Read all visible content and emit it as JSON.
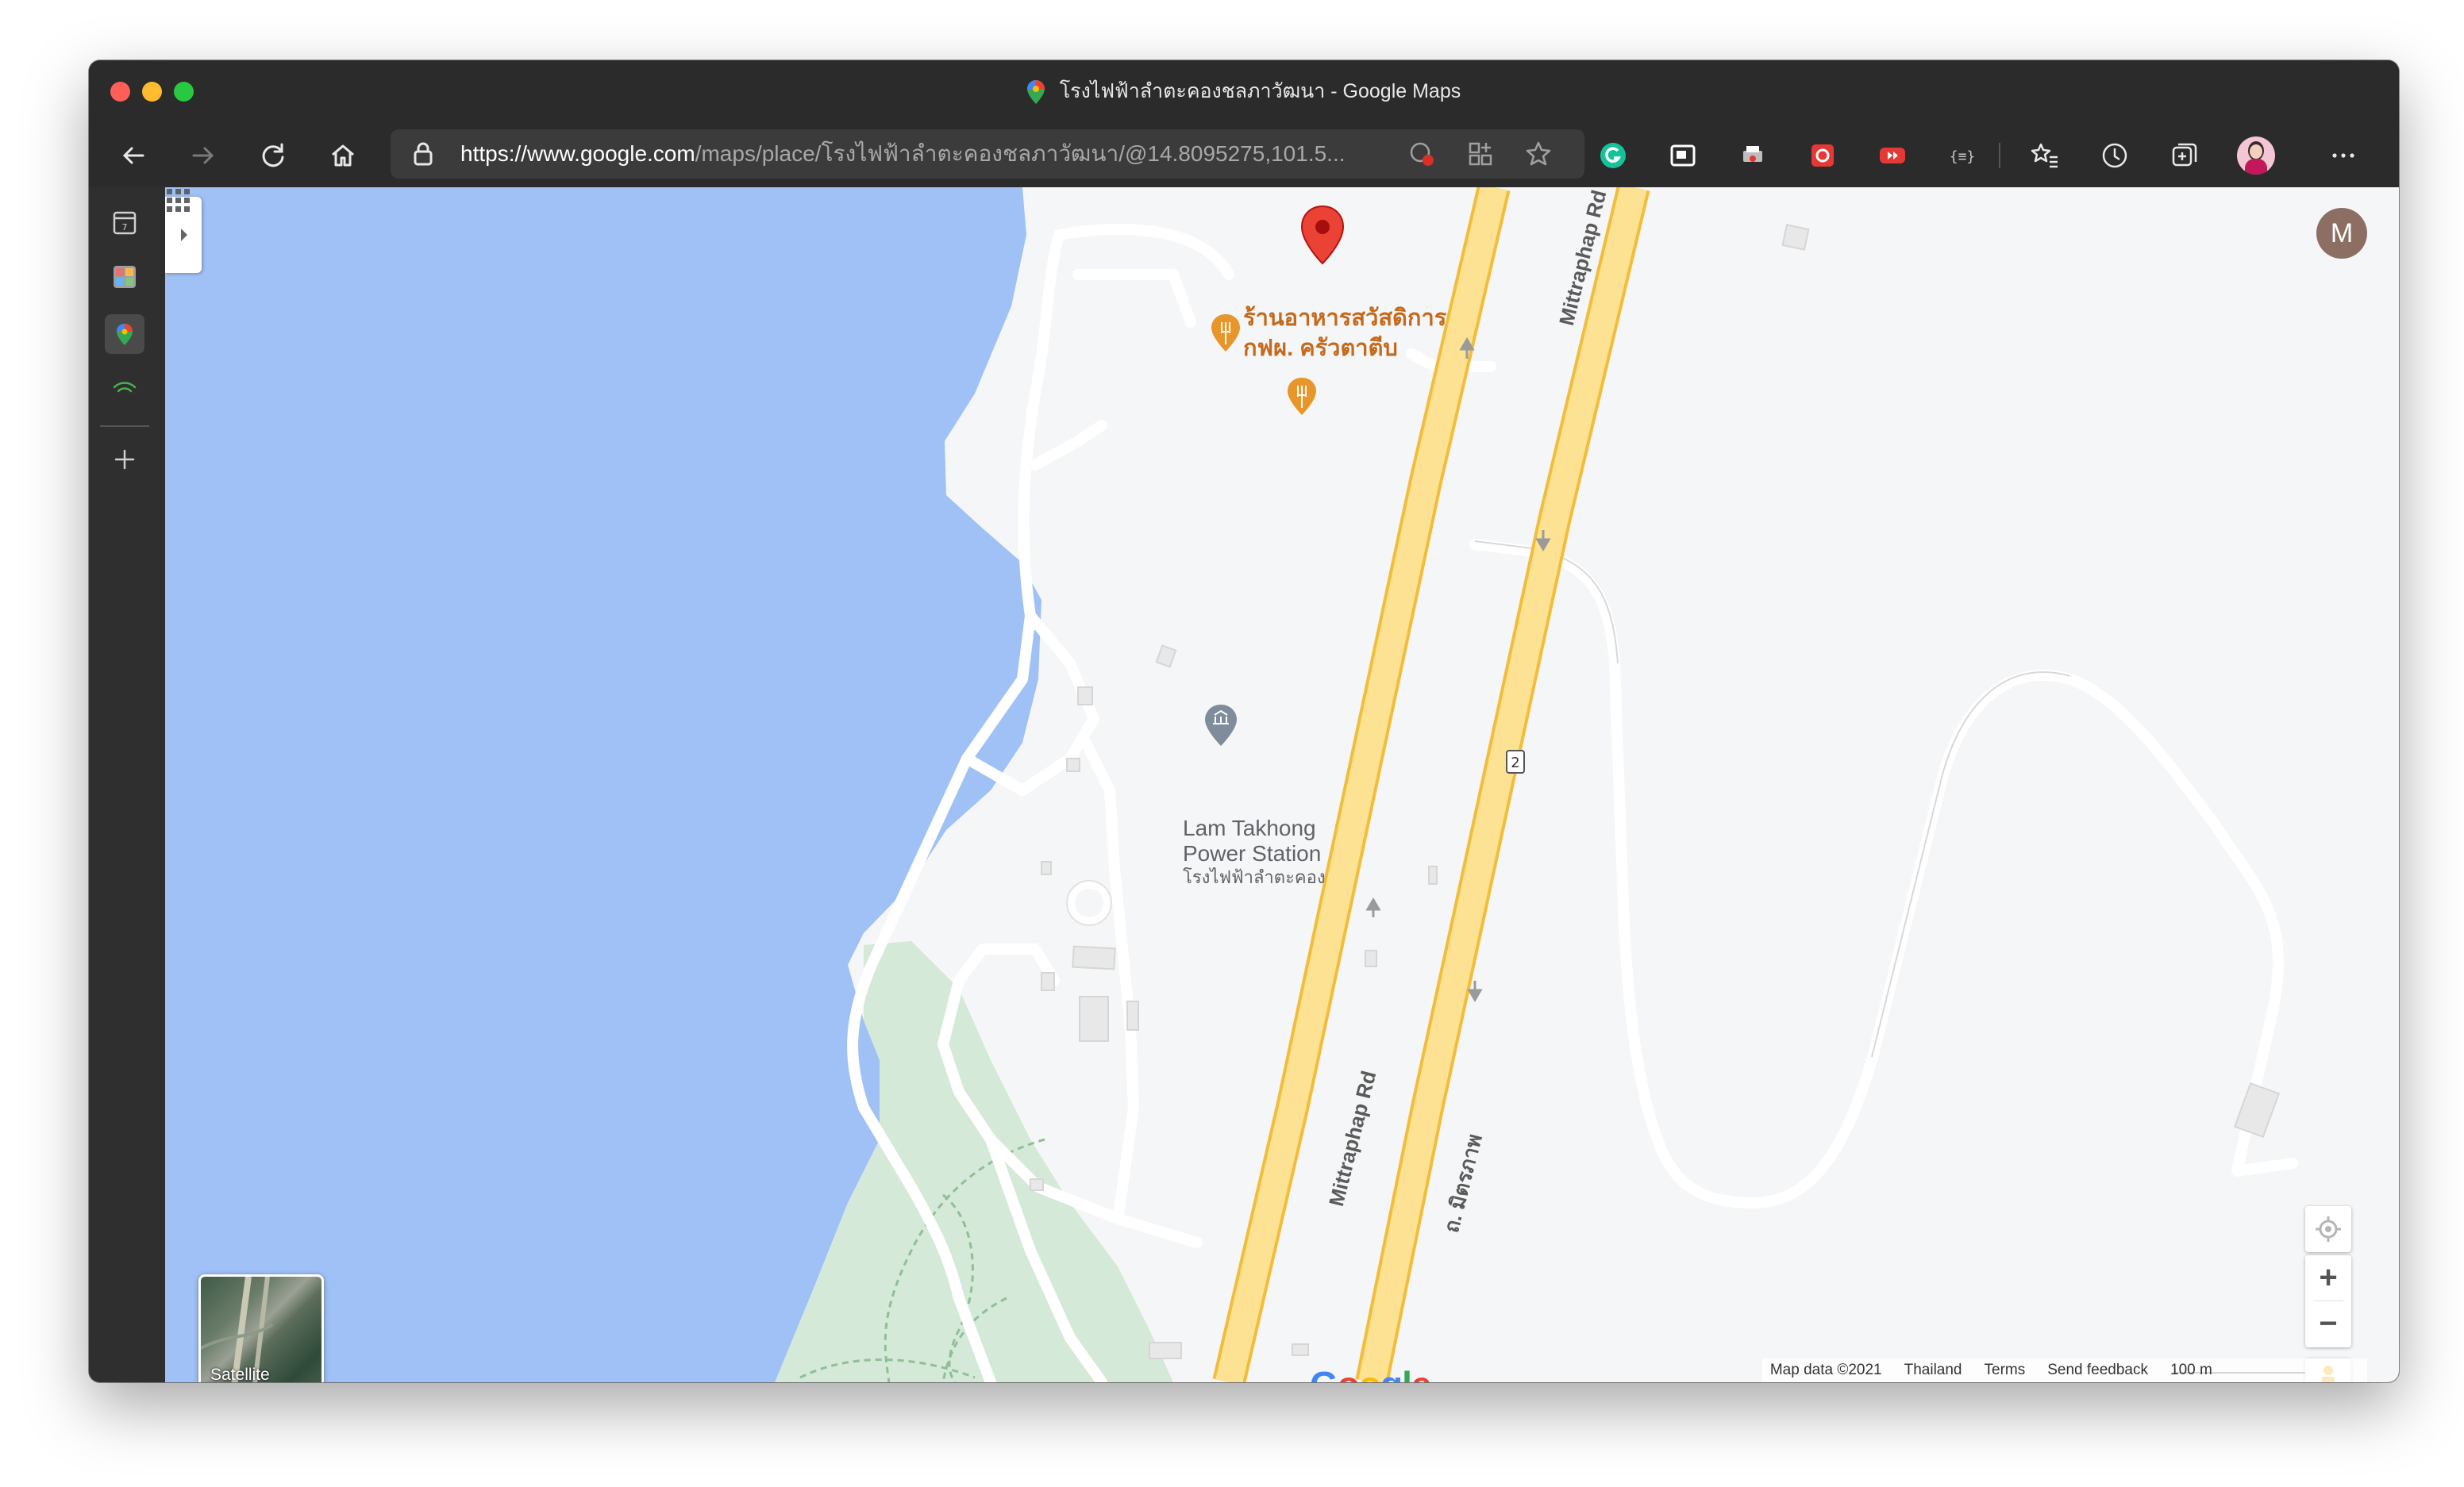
{
  "window": {
    "title": "โรงไฟฟ้าลำตะคองชลภาวัฒนา - Google Maps"
  },
  "toolbar": {
    "url_host": "https://www.google.com",
    "url_path": "/maps/place/โรงไฟฟ้าลำตะคองชลภาวัฒนา/@14.8095275,101.5..."
  },
  "map": {
    "restaurant_label_line1": "ร้านอาหารสวัสดิการ",
    "restaurant_label_line2": "กฟผ. ครัวตาตีบ",
    "power_station_line1": "Lam Takhong",
    "power_station_line2": "Power Station",
    "power_station_thai": "โรงไฟฟ้าลำตะคอง",
    "road_mittraphap_upper": "Mittraphap Rd",
    "road_mittraphap_lower": "Mittraphap Rd",
    "road_thai": "ถ. มิตรภาพ",
    "route_number": "2",
    "google_logo": "Google",
    "satellite_label": "Satellite",
    "avatar_initial": "M"
  },
  "footer": {
    "map_data": "Map data ©2021",
    "region": "Thailand",
    "terms": "Terms",
    "feedback": "Send feedback",
    "scale": "100 m"
  },
  "colors": {
    "water": "#a0c1f5",
    "land": "#f5f6f7",
    "park": "#d4e9d7",
    "highway": "#fde293",
    "highway_edge": "#f2bd3a",
    "pin": "#ea4335",
    "poi_restaurant": "#e8952a"
  }
}
